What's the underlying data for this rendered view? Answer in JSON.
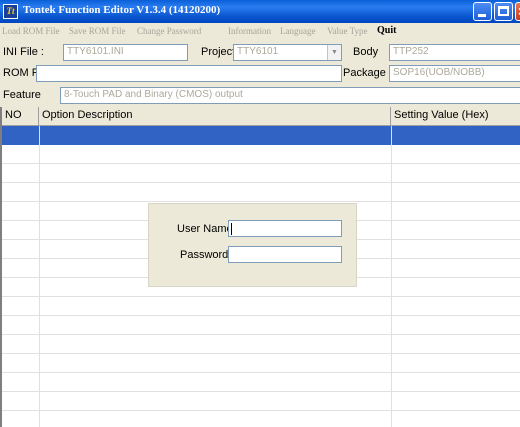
{
  "window": {
    "title": "Tontek Function Editor V1.3.4 (14120200)",
    "app_icon_text": "Tt"
  },
  "menu": [
    {
      "label": "Load ROM File",
      "enabled": false
    },
    {
      "label": "Save ROM File",
      "enabled": false
    },
    {
      "label": "Change Password",
      "enabled": false
    },
    {
      "label": "Information",
      "enabled": false
    },
    {
      "label": "Language",
      "enabled": false
    },
    {
      "label": "Value Type",
      "enabled": false
    },
    {
      "label": "Quit",
      "enabled": true
    }
  ],
  "form": {
    "ini_file_label": "INI File :",
    "ini_file_value": "TTY6101.INI",
    "project_label": "Project",
    "project_value": "TTY6101",
    "body_label": "Body",
    "body_value": "TTP252",
    "rom_file_label": "ROM File",
    "rom_file_value": "",
    "package_label": "Package",
    "package_value": "SOP16(UOB/NOBB)",
    "feature_label": "Feature",
    "feature_value": "8-Touch PAD and Binary (CMOS) output"
  },
  "table": {
    "columns": [
      "NO",
      "Option Description",
      "Setting Value (Hex)"
    ],
    "selected_row": 0
  },
  "login": {
    "username_label": "User Name:",
    "username_value": "",
    "password_label": "Password :",
    "password_value": ""
  },
  "colors": {
    "titlebar": "#0a5fd8",
    "selection": "#3163c5",
    "face": "#ece9d8"
  }
}
